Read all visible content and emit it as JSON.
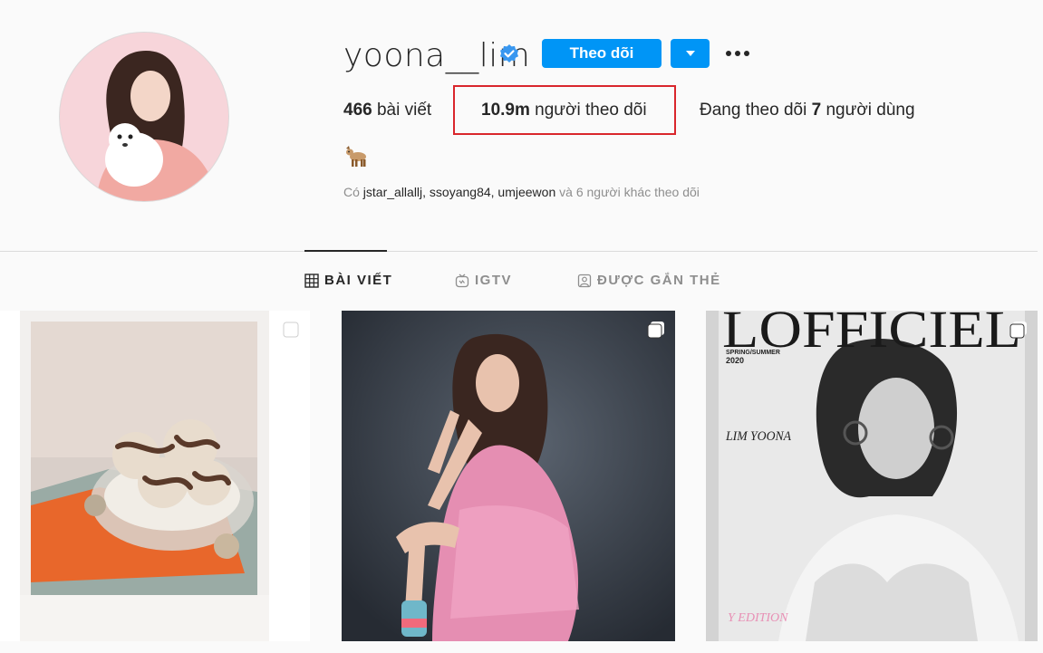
{
  "profile": {
    "username": "yoona__lim",
    "follow_label": "Theo dõi",
    "stats": {
      "posts_count": "466",
      "posts_label": "bài viết",
      "followers_count": "10.9m",
      "followers_label": "người theo dõi",
      "following_prefix": "Đang theo dõi",
      "following_count": "7",
      "following_suffix": "người dùng"
    },
    "followed_by": {
      "prefix": "Có",
      "accounts": "jstar_allallj, ssoyang84, umjeewon",
      "suffix": "và 6 người khác theo dõi"
    }
  },
  "tabs": [
    {
      "label": "BÀI VIẾT",
      "icon": "grid-icon",
      "active": true
    },
    {
      "label": "IGTV",
      "icon": "igtv-icon",
      "active": false
    },
    {
      "label": "ĐƯỢC GẮN THẺ",
      "icon": "tagged-icon",
      "active": false
    }
  ],
  "posts": [
    {
      "icon": "multi-post-icon"
    },
    {
      "icon": "multi-post-icon"
    },
    {
      "icon": "multi-post-icon",
      "magazine": {
        "masthead": "LOFFICIEL",
        "season": "SPRING/SUMMER",
        "year": "2020",
        "cover_line": "LIM YOONA",
        "badge": "Y EDITION"
      }
    }
  ],
  "colors": {
    "accent": "#0095f6",
    "highlight": "#d9262c",
    "verified": "#3897f0"
  }
}
